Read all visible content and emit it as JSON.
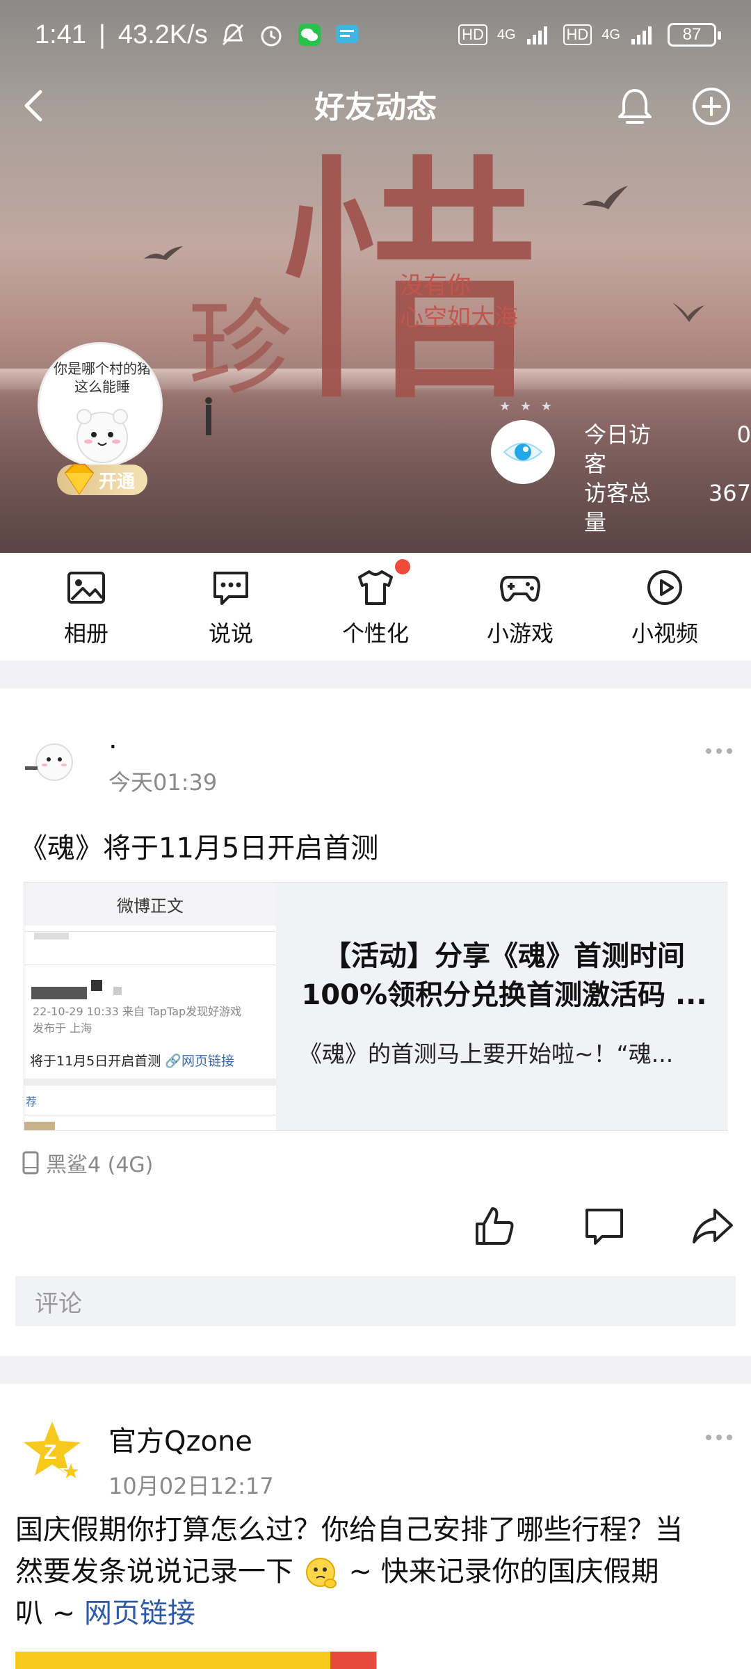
{
  "status_bar": {
    "time": "1:41",
    "speed": "43.2K/s",
    "net1": "4G",
    "net2": "4G",
    "hd1": "HD",
    "hd2": "HD",
    "battery": "87"
  },
  "nav": {
    "title": "好友动态"
  },
  "cover": {
    "big_char": "惜",
    "small_char": "珍",
    "caption_line1": "没有你",
    "caption_line2": "心空如大海",
    "avatar_text": "你是哪个村的猪 这么能睡",
    "vip_label": "开通",
    "visitors": {
      "today_label": "今日访客",
      "today_value": "0",
      "total_label": "访客总量",
      "total_value": "367"
    }
  },
  "quickbar": [
    {
      "label": "相册",
      "icon": "photo-album-icon"
    },
    {
      "label": "说说",
      "icon": "chat-bubble-icon"
    },
    {
      "label": "个性化",
      "icon": "tshirt-icon"
    },
    {
      "label": "小游戏",
      "icon": "gamepad-icon"
    },
    {
      "label": "小视频",
      "icon": "play-icon"
    }
  ],
  "posts": [
    {
      "author": ".",
      "time": "今天01:39",
      "text": "《魂》将于11月5日开启首测",
      "share": {
        "thumb_header": "微博正文",
        "thumb_meta1": "22-10-29 10:33  来自 TapTap发现好游戏",
        "thumb_meta2": "发布于 上海",
        "thumb_text": "将于11月5日开启首测",
        "thumb_link": "🔗网页链接",
        "thumb_recommend": "荐",
        "title_line1": "【活动】分享《魂》首测时间",
        "title_line2": "100%领积分兑换首测激活码 ...",
        "desc": "《魂》的首测马上要开始啦~！“魂..."
      },
      "device": "黑鲨4 (4G)",
      "comment_placeholder": "评论"
    },
    {
      "author": "官方Qzone",
      "time": "10月02日12:17",
      "text_line1": "国庆假期你打算怎么过？你给自己安排了哪些行程？当",
      "text_line2a": "然要发条说说记录一下",
      "text_line2b": " ~ 快来记录你的国庆假期",
      "text_line3a": "叭 ~ ",
      "text_link": "网页链接"
    }
  ],
  "colors": {
    "accent_red": "#ef4b3b",
    "link_blue": "#2d5aa8",
    "qzone_yellow": "#f8c91d"
  }
}
